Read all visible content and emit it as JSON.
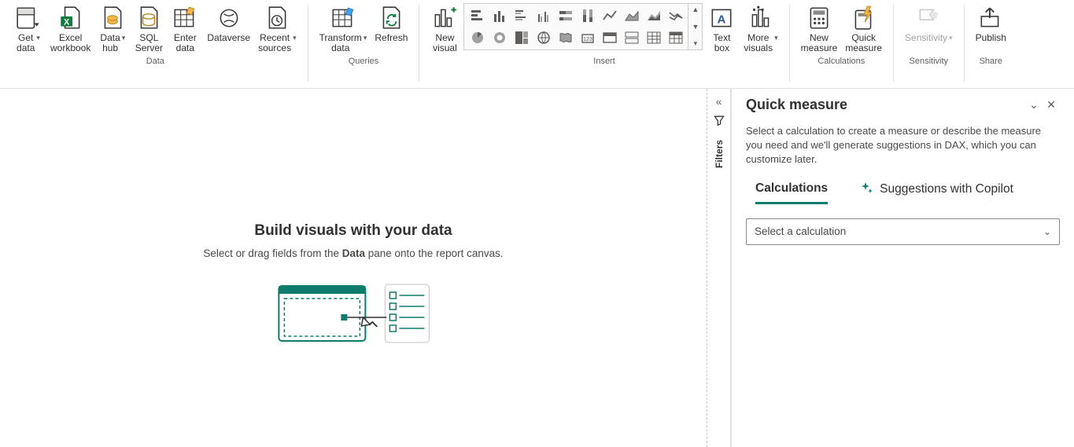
{
  "ribbon": {
    "data": {
      "label": "Data",
      "items": [
        {
          "id": "get-data",
          "label": "Get\ndata",
          "dropdown": true
        },
        {
          "id": "excel-workbook",
          "label": "Excel\nworkbook"
        },
        {
          "id": "data-hub",
          "label": "Data\nhub",
          "dropdown": true
        },
        {
          "id": "sql-server",
          "label": "SQL\nServer"
        },
        {
          "id": "enter-data",
          "label": "Enter\ndata"
        },
        {
          "id": "dataverse",
          "label": "Dataverse"
        },
        {
          "id": "recent-sources",
          "label": "Recent\nsources",
          "dropdown": true
        }
      ]
    },
    "queries": {
      "label": "Queries",
      "items": [
        {
          "id": "transform-data",
          "label": "Transform\ndata",
          "dropdown": true
        },
        {
          "id": "refresh",
          "label": "Refresh"
        }
      ]
    },
    "insert": {
      "label": "Insert",
      "items": [
        {
          "id": "new-visual",
          "label": "New\nvisual"
        },
        {
          "id": "viz-gallery",
          "label": ""
        },
        {
          "id": "text-box",
          "label": "Text\nbox"
        },
        {
          "id": "more-visuals",
          "label": "More\nvisuals",
          "dropdown": true
        }
      ]
    },
    "calculations": {
      "label": "Calculations",
      "items": [
        {
          "id": "new-measure",
          "label": "New\nmeasure"
        },
        {
          "id": "quick-measure",
          "label": "Quick\nmeasure"
        }
      ]
    },
    "sensitivity": {
      "label": "Sensitivity",
      "items": [
        {
          "id": "sensitivity",
          "label": "Sensitivity",
          "dropdown": true,
          "disabled": true
        }
      ]
    },
    "share": {
      "label": "Share",
      "items": [
        {
          "id": "publish",
          "label": "Publish"
        }
      ]
    }
  },
  "canvas": {
    "title": "Build visuals with your data",
    "subtitle_pre": "Select or drag fields from the ",
    "subtitle_bold": "Data",
    "subtitle_post": " pane onto the report canvas."
  },
  "rail": {
    "label": "Filters"
  },
  "pane": {
    "title": "Quick measure",
    "desc": "Select a calculation to create a measure or describe the measure you need and we'll generate suggestions in DAX, which you can customize later.",
    "tabs": {
      "calculations": "Calculations",
      "suggestions": "Suggestions with Copilot"
    },
    "select_placeholder": "Select a calculation"
  }
}
